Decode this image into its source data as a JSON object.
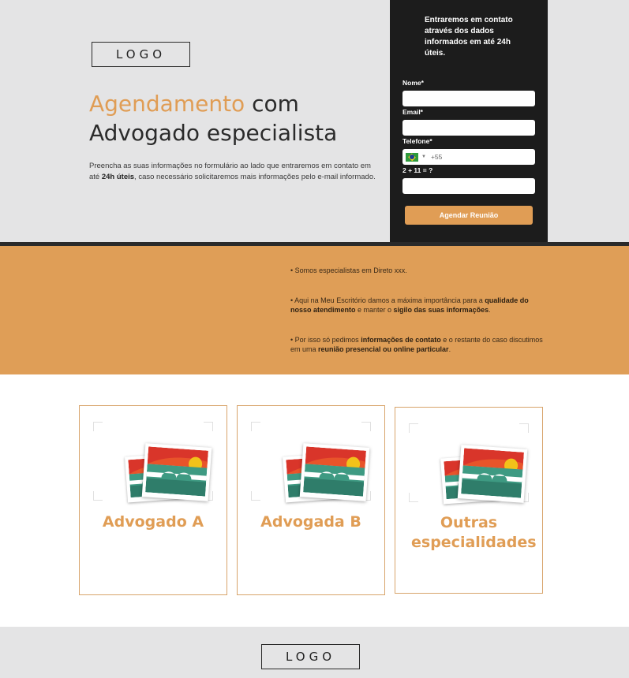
{
  "hero": {
    "logo": "LOGO",
    "title_accent": "Agendamento",
    "title_rest_1": " com",
    "title_rest_2": "Advogado especialista",
    "desc_1": "Preencha as suas informações no formulário ao lado que entraremos em contato em até ",
    "desc_bold": "24h úteis",
    "desc_2": ", caso necessário solicitaremos mais informações pelo e-mail informado."
  },
  "form": {
    "intro": "Entraremos em contato através dos dados informados em até 24h úteis.",
    "name_label": "Nome*",
    "email_label": "Email*",
    "phone_label": "Telefone*",
    "phone_dial": "+55",
    "captcha_label": "2 + 11 = ?",
    "submit_label": "Agendar Reunião",
    "flag_icon": "brazil-flag-icon"
  },
  "band": {
    "b1": "• Somos especialistas em Direto xxx.",
    "b2_a": "• Aqui na Meu Escritório damos a máxima importância para a ",
    "b2_b": "qualidade do nosso atendimento",
    "b2_c": " e manter o ",
    "b2_d": "sigilo das suas informações",
    "b2_e": ".",
    "b3_a": "•  Por isso só pedimos ",
    "b3_b": "informações de contato",
    "b3_c": " e o restante do caso discutimos em uma ",
    "b3_d": "reunião presencial ou online particular",
    "b3_e": "."
  },
  "cards": [
    {
      "title": "Advogado A",
      "icon": "image-placeholder-icon"
    },
    {
      "title": "Advogada B",
      "icon": "image-placeholder-icon"
    },
    {
      "title": "Outras especialidades",
      "icon": "image-placeholder-icon"
    }
  ],
  "footer": {
    "logo": "LOGO"
  },
  "colors": {
    "accent": "#e09d55",
    "dark": "#1c1c1c",
    "light_gray": "#e4e4e5"
  }
}
